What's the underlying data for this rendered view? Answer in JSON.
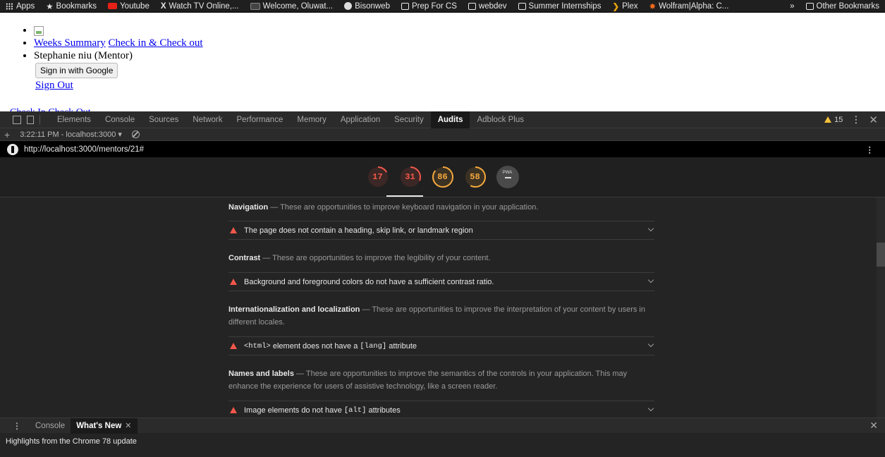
{
  "bookmarks_bar": {
    "items": [
      "Apps",
      "Bookmarks",
      "Youtube",
      "Watch TV Online,...",
      "Welcome, Oluwat...",
      "Bisonweb",
      "Prep For CS",
      "webdev",
      "Summer Internships",
      "Plex",
      "Wolfram|Alpha: C...",
      "»",
      "Other Bookmarks"
    ]
  },
  "page": {
    "nav_link_1": "Weeks Summary",
    "nav_link_2": "Check in & Check out",
    "user_label": "Stephanie niu (Mentor)",
    "google_button": "Sign in with Google",
    "sign_out": "Sign Out",
    "cut_text": "Check In Check Out"
  },
  "devtools": {
    "tabs": [
      "Elements",
      "Console",
      "Sources",
      "Network",
      "Performance",
      "Memory",
      "Application",
      "Security",
      "Audits",
      "Adblock Plus"
    ],
    "active_tab": "Audits",
    "warning_count": "15",
    "session": "3:22:11 PM - localhost:3000",
    "url": "http://localhost:3000/mentors/21#",
    "scores": [
      {
        "value": 17,
        "label": "17",
        "color": "#f2574a"
      },
      {
        "value": 31,
        "label": "31",
        "color": "#f2574a"
      },
      {
        "value": 86,
        "label": "86",
        "color": "#f5a93d"
      },
      {
        "value": 58,
        "label": "58",
        "color": "#f5a93d"
      }
    ],
    "pwa_label": "PWA",
    "groups": [
      {
        "title": "Navigation",
        "desc": " — These are opportunities to improve keyboard navigation in your application.",
        "audit": "The page does not contain a heading, skip link, or landmark region"
      },
      {
        "title": "Contrast",
        "desc": " — These are opportunities to improve the legibility of your content.",
        "audit": "Background and foreground colors do not have a sufficient contrast ratio."
      },
      {
        "title": "Internationalization and localization",
        "desc": " — These are opportunities to improve the interpretation of your content by users in different locales.",
        "audit_code1": "<html>",
        "audit_mid": " element does not have a ",
        "audit_code2": "[lang]",
        "audit_end": " attribute"
      },
      {
        "title": "Names and labels",
        "desc": " — These are opportunities to improve the semantics of the controls in your application. This may enhance the experience for users of assistive technology, like a screen reader.",
        "audit_pre": "Image elements do not have ",
        "audit_code": "[alt]",
        "audit_end": " attributes"
      }
    ],
    "drawer": {
      "tabs": [
        "Console",
        "What's New"
      ],
      "active": "What's New",
      "content": "Highlights from the Chrome 78 update"
    }
  }
}
